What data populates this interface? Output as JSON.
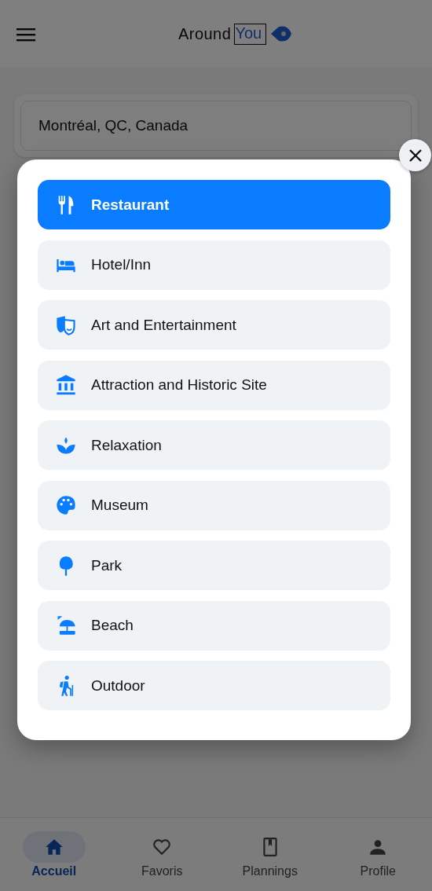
{
  "header": {
    "logo_part_1": "Around",
    "logo_part_2": "You"
  },
  "location_field": {
    "value": "Montréal, QC, Canada"
  },
  "category_dialog": {
    "categories": [
      {
        "label": "Restaurant",
        "selected": true
      },
      {
        "label": "Hotel/Inn",
        "selected": false
      },
      {
        "label": "Art and Entertainment",
        "selected": false
      },
      {
        "label": "Attraction and Historic Site",
        "selected": false
      },
      {
        "label": "Relaxation",
        "selected": false
      },
      {
        "label": "Museum",
        "selected": false
      },
      {
        "label": "Park",
        "selected": false
      },
      {
        "label": "Beach",
        "selected": false
      },
      {
        "label": "Outdoor",
        "selected": false
      }
    ]
  },
  "bottom_nav": [
    {
      "label": "Accueil",
      "selected": true
    },
    {
      "label": "Favoris",
      "selected": false
    },
    {
      "label": "Plannings",
      "selected": false
    },
    {
      "label": "Profile",
      "selected": false
    }
  ]
}
